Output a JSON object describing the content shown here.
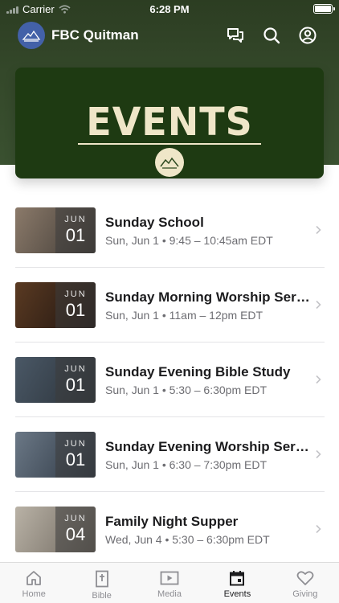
{
  "status_bar": {
    "carrier": "Carrier",
    "time": "6:28 PM"
  },
  "header": {
    "title": "FBC Quitman",
    "icons": [
      "chat-icon",
      "search-icon",
      "profile-icon"
    ]
  },
  "banner": {
    "title": "EVENTS"
  },
  "events": [
    {
      "month": "JUN",
      "day": "01",
      "title": "Sunday School",
      "subtitle": "Sun, Jun 1 • 9:45 – 10:45am EDT",
      "thumb_color_a": "#8b7a6a",
      "thumb_color_b": "#3f3a35"
    },
    {
      "month": "JUN",
      "day": "01",
      "title": "Sunday Morning Worship Serv...",
      "subtitle": "Sun, Jun 1 • 11am – 12pm EDT",
      "thumb_color_a": "#5a3a22",
      "thumb_color_b": "#1e1410"
    },
    {
      "month": "JUN",
      "day": "01",
      "title": "Sunday Evening Bible Study",
      "subtitle": "Sun, Jun 1 • 5:30 – 6:30pm EDT",
      "thumb_color_a": "#4a5866",
      "thumb_color_b": "#2a3138"
    },
    {
      "month": "JUN",
      "day": "01",
      "title": "Sunday Evening Worship Servi...",
      "subtitle": "Sun, Jun 1 • 6:30 – 7:30pm EDT",
      "thumb_color_a": "#6b7886",
      "thumb_color_b": "#2c3642"
    },
    {
      "month": "JUN",
      "day": "04",
      "title": "Family Night Supper",
      "subtitle": "Wed, Jun 4 • 5:30 – 6:30pm EDT",
      "thumb_color_a": "#b9b2a6",
      "thumb_color_b": "#6e675e"
    }
  ],
  "tabs": [
    {
      "label": "Home",
      "icon": "home-icon",
      "active": false
    },
    {
      "label": "Bible",
      "icon": "bible-icon",
      "active": false
    },
    {
      "label": "Media",
      "icon": "media-icon",
      "active": false
    },
    {
      "label": "Events",
      "icon": "calendar-icon",
      "active": true
    },
    {
      "label": "Giving",
      "icon": "heart-icon",
      "active": false
    }
  ],
  "colors": {
    "header_green": "#34482a",
    "banner_green": "#1e3a12",
    "banner_text": "#efe6c8",
    "logo_blue": "#4361a8"
  }
}
